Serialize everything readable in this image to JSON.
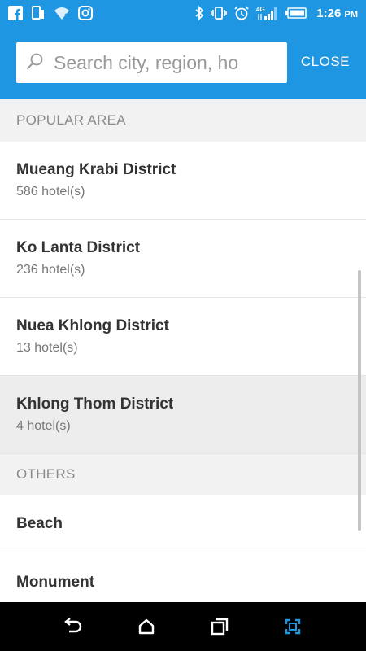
{
  "colors": {
    "header": "#1e96e1",
    "section_bg": "#f2f2f2",
    "selected_bg": "#ededed",
    "nav_accent": "#1e96e1"
  },
  "status_bar": {
    "left_icons": [
      "facebook-icon",
      "device-icon",
      "wifi-question-icon",
      "instagram-icon"
    ],
    "right_icons": [
      "bluetooth-icon",
      "vibrate-icon",
      "alarm-icon",
      "4g-signal-icon",
      "battery-icon"
    ],
    "network_label": "4G",
    "time": "1:26",
    "ampm": "PM"
  },
  "search": {
    "placeholder": "Search city, region, ho",
    "close_label": "CLOSE"
  },
  "sections": {
    "popular_label": "POPULAR AREA",
    "others_label": "OTHERS"
  },
  "popular_items": [
    {
      "name": "Mueang Krabi District",
      "count": "586 hotel(s)"
    },
    {
      "name": "Ko Lanta District",
      "count": "236 hotel(s)"
    },
    {
      "name": "Nuea Khlong District",
      "count": "13 hotel(s)"
    },
    {
      "name": "Khlong Thom District",
      "count": "4 hotel(s)"
    }
  ],
  "other_items": [
    {
      "name": "Beach"
    },
    {
      "name": "Monument"
    }
  ],
  "nav": [
    "back-icon",
    "home-icon",
    "recents-icon",
    "screenshot-icon"
  ]
}
